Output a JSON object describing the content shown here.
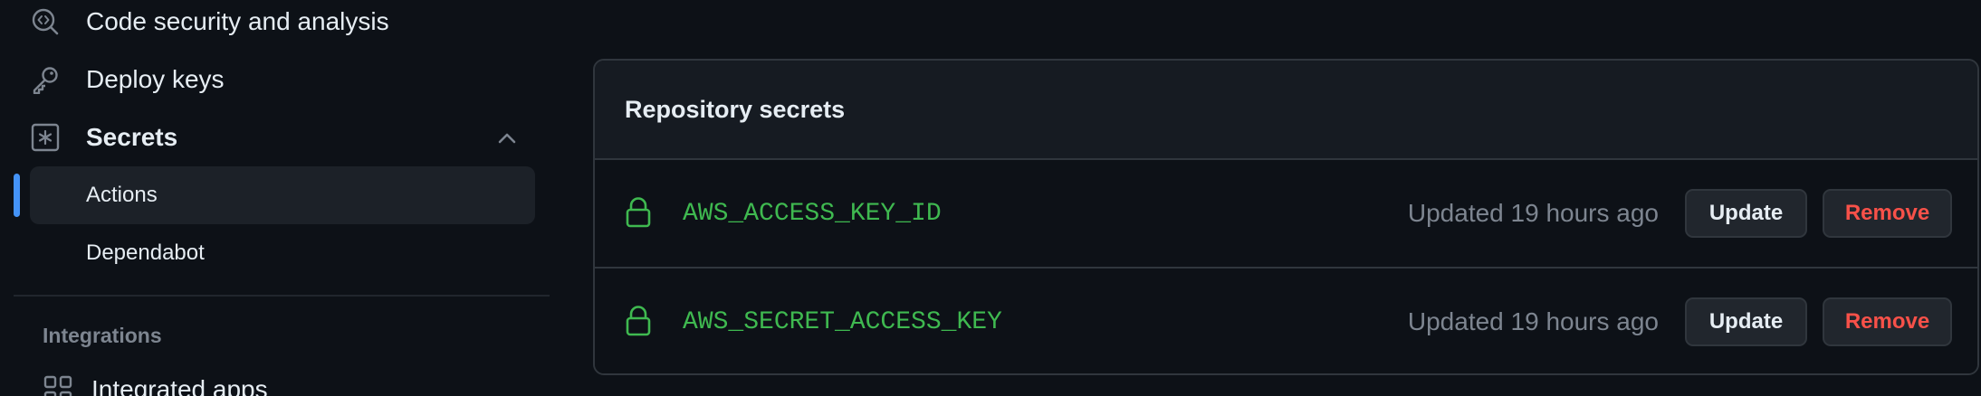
{
  "sidebar": {
    "code_security": {
      "label": "Code security and analysis",
      "icon": "codescan-icon"
    },
    "deploy_keys": {
      "label": "Deploy keys",
      "icon": "key-icon"
    },
    "secrets": {
      "label": "Secrets",
      "icon": "asterisk-icon",
      "expanded": true
    },
    "secrets_sub": [
      {
        "label": "Actions",
        "active": true
      },
      {
        "label": "Dependabot",
        "active": false
      }
    ],
    "integrations_heading": "Integrations",
    "integrated_apps": {
      "label": "Integrated apps",
      "icon": "apps-icon"
    }
  },
  "main": {
    "card_title": "Repository secrets",
    "secrets": [
      {
        "name": "AWS_ACCESS_KEY_ID",
        "updated": "Updated 19 hours ago",
        "update_label": "Update",
        "remove_label": "Remove"
      },
      {
        "name": "AWS_SECRET_ACCESS_KEY",
        "updated": "Updated 19 hours ago",
        "update_label": "Update",
        "remove_label": "Remove"
      }
    ]
  },
  "colors": {
    "background": "#0d1117",
    "accent": "#4493f8",
    "secret_name": "#3fb950",
    "danger": "#f85149",
    "muted": "#7d8590"
  }
}
